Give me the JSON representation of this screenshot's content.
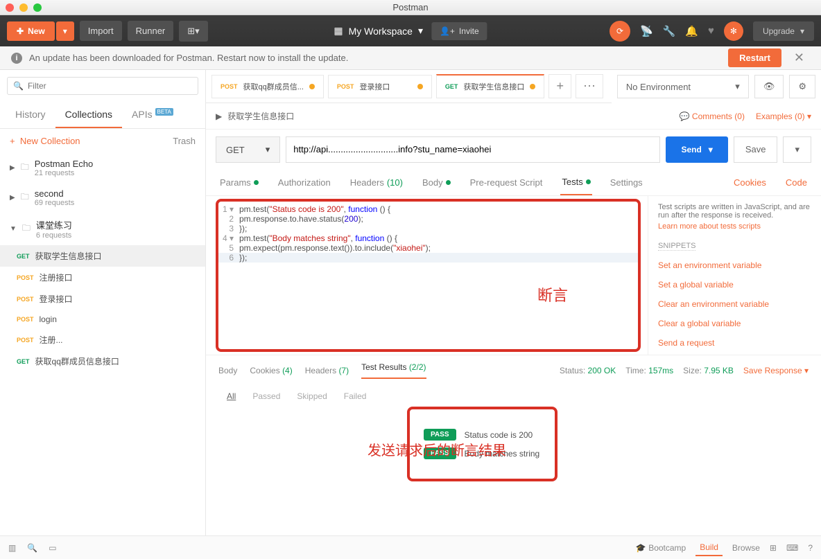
{
  "window": {
    "title": "Postman"
  },
  "toolbar": {
    "new": "New",
    "import": "Import",
    "runner": "Runner",
    "workspace": "My Workspace",
    "invite": "Invite",
    "upgrade": "Upgrade"
  },
  "banner": {
    "message": "An update has been downloaded for Postman. Restart now to install the update.",
    "restart": "Restart"
  },
  "sidebar": {
    "filter_placeholder": "Filter",
    "tabs": {
      "history": "History",
      "collections": "Collections",
      "apis": "APIs",
      "apis_badge": "BETA"
    },
    "new_collection": "New Collection",
    "trash": "Trash",
    "collections": [
      {
        "name": "Postman Echo",
        "count": "21 requests"
      },
      {
        "name": "second",
        "count": "69 requests"
      },
      {
        "name": "课堂练习",
        "count": "6 requests"
      }
    ],
    "requests": [
      {
        "method": "GET",
        "name": "获取学生信息接口",
        "selected": true
      },
      {
        "method": "POST",
        "name": "注册接口"
      },
      {
        "method": "POST",
        "name": "登录接口"
      },
      {
        "method": "POST",
        "name": "login"
      },
      {
        "method": "POST",
        "name": "注册..."
      },
      {
        "method": "GET",
        "name": "获取qq群成员信息接口"
      }
    ]
  },
  "tabs": [
    {
      "method": "POST",
      "label": "获取qq群成员信..."
    },
    {
      "method": "POST",
      "label": "登录接口"
    },
    {
      "method": "GET",
      "label": "获取学生信息接口",
      "active": true
    }
  ],
  "environment": {
    "selected": "No Environment"
  },
  "breadcrumb": {
    "title": "获取学生信息接口",
    "comments": "Comments (0)",
    "examples": "Examples (0)"
  },
  "request": {
    "method": "GET",
    "url": "http://api............................info?stu_name=xiaohei",
    "send": "Send",
    "save": "Save"
  },
  "req_tabs": {
    "params": "Params",
    "auth": "Authorization",
    "headers": "Headers",
    "headers_n": "(10)",
    "body": "Body",
    "prereq": "Pre-request Script",
    "tests": "Tests",
    "settings": "Settings",
    "cookies": "Cookies",
    "code": "Code"
  },
  "code": {
    "l1a": "pm.test(",
    "l1b": "\"Status code is 200\"",
    "l1c": ", ",
    "l1d": "function",
    "l1e": " () {",
    "l2a": "    pm.response.to.have.status(",
    "l2b": "200",
    "l2c": ");",
    "l3": "});",
    "l4a": "pm.test(",
    "l4b": "\"Body matches string\"",
    "l4c": ", ",
    "l4d": "function",
    "l4e": " () {",
    "l5a": "    pm.expect(pm.response.text()).to.include(",
    "l5b": "\"xiaohei\"",
    "l5c": ");",
    "l6": "});",
    "annotation": "断言"
  },
  "snippets": {
    "hint": "Test scripts are written in JavaScript, and are run after the response is received.",
    "learn": "Learn more about tests scripts",
    "heading": "SNIPPETS",
    "items": [
      "Set an environment variable",
      "Set a global variable",
      "Clear an environment variable",
      "Clear a global variable",
      "Send a request"
    ]
  },
  "response": {
    "tabs": {
      "body": "Body",
      "cookies": "Cookies",
      "cookies_n": "(4)",
      "headers": "Headers",
      "headers_n": "(7)",
      "tests": "Test Results",
      "tests_n": "(2/2)"
    },
    "status_l": "Status:",
    "status_v": "200 OK",
    "time_l": "Time:",
    "time_v": "157ms",
    "size_l": "Size:",
    "size_v": "7.95 KB",
    "save": "Save Response"
  },
  "filter_tabs": {
    "all": "All",
    "passed": "Passed",
    "skipped": "Skipped",
    "failed": "Failed"
  },
  "results": {
    "items": [
      {
        "status": "PASS",
        "text": "Status code is 200"
      },
      {
        "status": "PASS",
        "text": "Body matches string"
      }
    ],
    "annotation": "发送请求后的断言结果"
  },
  "footer": {
    "bootcamp": "Bootcamp",
    "build": "Build",
    "browse": "Browse"
  }
}
